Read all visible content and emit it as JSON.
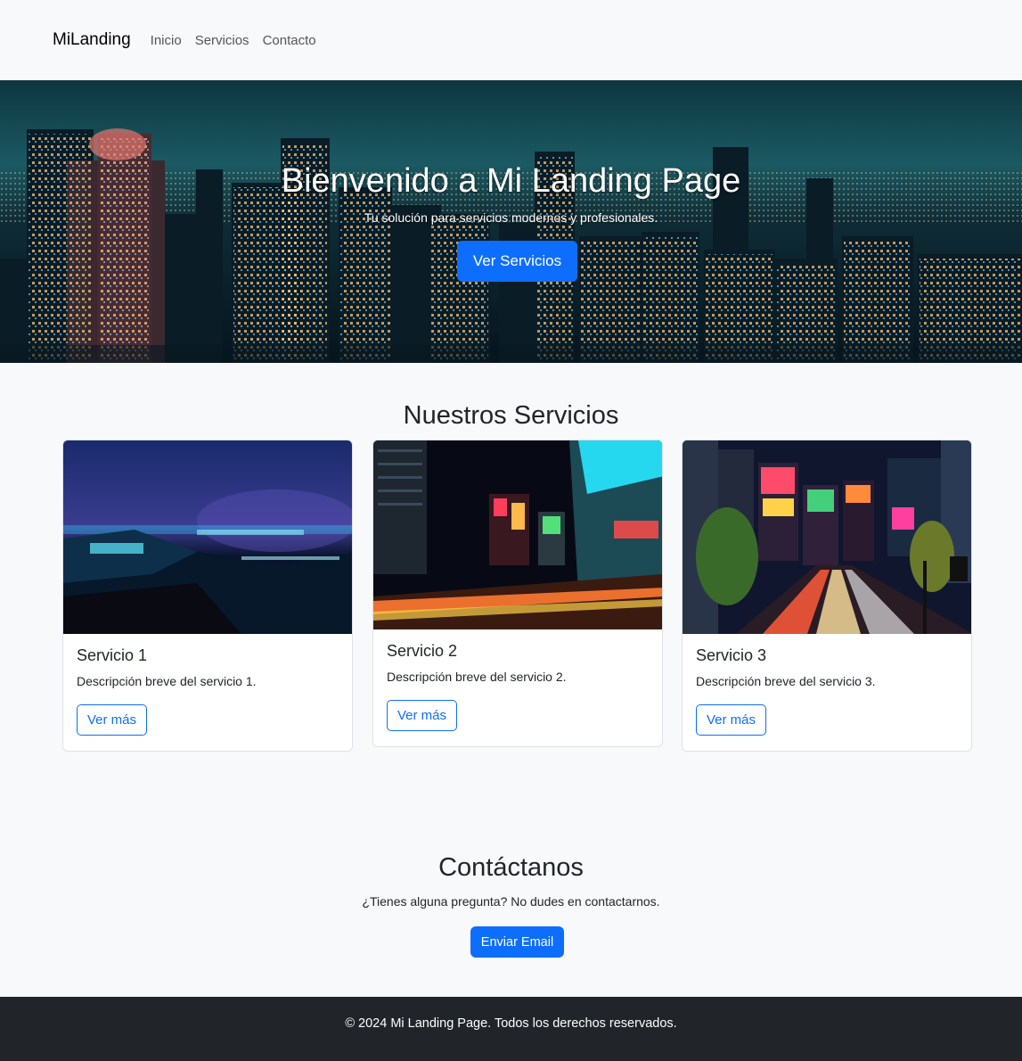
{
  "navbar": {
    "brand": "MiLanding",
    "links": [
      "Inicio",
      "Servicios",
      "Contacto"
    ]
  },
  "hero": {
    "title": "Bienvenido a Mi Landing Page",
    "subtitle": "Tu solución para servicios modernos y profesionales.",
    "button": "Ver Servicios"
  },
  "services": {
    "title": "Nuestros Servicios",
    "cards": [
      {
        "title": "Servicio 1",
        "text": "Descripción breve del servicio 1.",
        "button": "Ver más"
      },
      {
        "title": "Servicio 2",
        "text": "Descripción breve del servicio 2.",
        "button": "Ver más"
      },
      {
        "title": "Servicio 3",
        "text": "Descripción breve del servicio 3.",
        "button": "Ver más"
      }
    ]
  },
  "contact": {
    "title": "Contáctanos",
    "text": "¿Tienes alguna pregunta? No dudes en contactarnos.",
    "button": "Enviar Email"
  },
  "footer": {
    "text": "© 2024 Mi Landing Page. Todos los derechos reservados."
  },
  "colors": {
    "primary": "#0d6efd",
    "background": "#f8f9fa",
    "footer": "#212529"
  }
}
